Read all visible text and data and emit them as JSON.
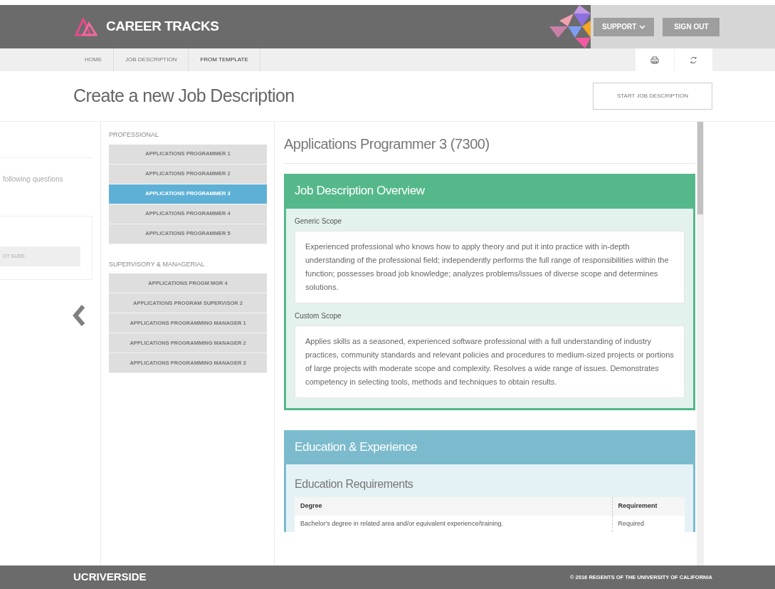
{
  "header": {
    "logo_text": "CAREER TRACKS",
    "support_button": "SUPPORT",
    "sign_out_button": "SIGN OUT"
  },
  "breadcrumb": [
    {
      "label": "HOME",
      "current": false
    },
    {
      "label": "JOB DESCRIPTION",
      "current": false
    },
    {
      "label": "FROM TEMPLATE",
      "current": true
    }
  ],
  "page_title": "Create a new Job Description",
  "start_button": "START JOB DESCRIPTION",
  "left_panel": {
    "question_text": "following questions",
    "option_button": "OT SURE"
  },
  "job_groups": [
    {
      "heading": "PROFESSIONAL",
      "items": [
        {
          "label": "APPLICATIONS PROGRAMMER 1",
          "selected": false
        },
        {
          "label": "APPLICATIONS PROGRAMMER 2",
          "selected": false
        },
        {
          "label": "APPLICATIONS PROGRAMMER 3",
          "selected": true
        },
        {
          "label": "APPLICATIONS PROGRAMMER 4",
          "selected": false
        },
        {
          "label": "APPLICATIONS PROGRAMMER 5",
          "selected": false
        }
      ]
    },
    {
      "heading": "SUPERVISORY & MANAGERIAL",
      "items": [
        {
          "label": "APPLICATIONS PROGM MGR 4",
          "selected": false
        },
        {
          "label": "APPLICATIONS PROGRAM SUPERVISOR 2",
          "selected": false
        },
        {
          "label": "APPLICATIONS PROGRAMMING MANAGER 1",
          "selected": false
        },
        {
          "label": "APPLICATIONS PROGRAMMING MANAGER 2",
          "selected": false
        },
        {
          "label": "APPLICATIONS PROGRAMMING MANAGER 3",
          "selected": false
        }
      ]
    }
  ],
  "job_title": "Applications Programmer 3 (7300)",
  "overview": {
    "title": "Job Description Overview",
    "sections": [
      {
        "label": "Generic Scope",
        "text": "Experienced professional who knows how to apply theory and put it into practice with in-depth understanding of the professional field; independently performs the full range of responsibilities within the function; possesses broad job knowledge; analyzes problems/issues of diverse scope and determines solutions."
      },
      {
        "label": "Custom Scope",
        "text": "Applies skills as a seasoned, experienced software professional with a full understanding of industry practices, community standards and relevant policies and procedures to medium-sized projects or portions of large projects with moderate scope and complexity. Resolves a wide range of issues. Demonstrates competency in selecting tools, methods and techniques to obtain results."
      }
    ]
  },
  "education": {
    "title": "Education & Experience",
    "subtitle": "Education Requirements",
    "columns": [
      "Degree",
      "Requirement"
    ],
    "rows": [
      [
        "Bachelor's degree in related area and/or equivalent experience/training.",
        "Required"
      ]
    ]
  },
  "footer": {
    "logo_text": "UCRIVERSIDE",
    "copyright": "© 2016 REGENTS OF THE UNIVERSITY OF CALIFORNIA"
  }
}
